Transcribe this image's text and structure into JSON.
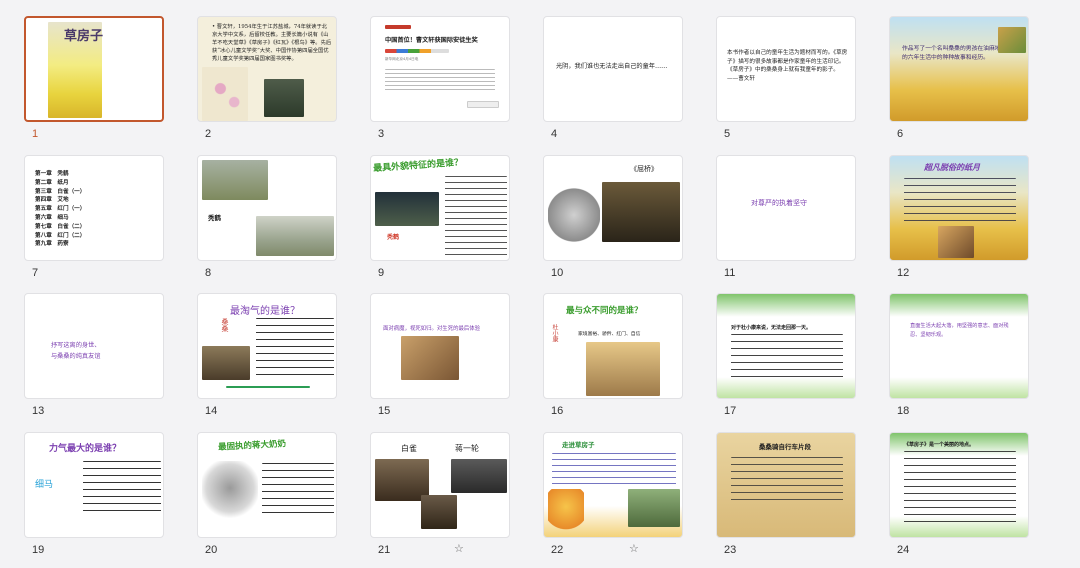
{
  "slides": [
    {
      "num": "1",
      "selected": true,
      "title": "草房子"
    },
    {
      "num": "2",
      "text": "• 曹文轩，1954年生于江苏盐城，74年就读于北京大学中文系，后留校任教。主要长篇小说有《山羊不吃天堂草》《草房子》《红瓦》《根鸟》等。先后获“冰心儿童文学奖”大奖、中国作协第四届全国优秀儿童文学奖第四届国家图书奖等。"
    },
    {
      "num": "3",
      "heading": "中国首位！曹文轩获国际安徒生奖",
      "subline": "新华网北京4月4日电"
    },
    {
      "num": "4",
      "text": "光阴，我们谁也无法走出自己的童年……"
    },
    {
      "num": "5",
      "text": "本书作者以自己的童年生活为题材而写的。《草房子》描写的很多故事都是作家童年的生活印记。《草房子》中的桑桑身上就有我童年的影子。——曹文轩"
    },
    {
      "num": "6",
      "text": "作品写了一个名叫桑桑的男孩在油麻地小学的六年生活中的种种故事和经历。"
    },
    {
      "num": "7",
      "chapters": [
        "第一章　秃鹤",
        "第二章　纸月",
        "第三章　白雀（一）",
        "第四章　艾地",
        "第五章　红门（一）",
        "第六章　细马",
        "第七章　白雀（二）",
        "第八章　红门（二）",
        "第九章　药寮"
      ]
    },
    {
      "num": "8",
      "caption": "秃鹤"
    },
    {
      "num": "9",
      "heading": "最具外貌特征的是谁？",
      "caption": "秃鹤"
    },
    {
      "num": "10",
      "heading": "《屈桥》"
    },
    {
      "num": "11",
      "text": "对尊严的执着坚守"
    },
    {
      "num": "12",
      "heading": "超凡脱俗的纸月"
    },
    {
      "num": "13",
      "text": "抒写这离的身世、\n与桑桑的纯真友谊"
    },
    {
      "num": "14",
      "heading": "最淘气的是谁？",
      "side": "桑桑"
    },
    {
      "num": "15",
      "text": "面对病魔，视死如归。对生死的最后体验"
    },
    {
      "num": "16",
      "heading": "最与众不同的是谁？",
      "side": "杜小康",
      "sub": "家境富裕、骄矜、红门、自信"
    },
    {
      "num": "17",
      "text": "对于杜小康来说，无法走回那一天。"
    },
    {
      "num": "18",
      "text": "直面生活大起大落，用坚强的意志、面对残忍、坚韧乐观。"
    },
    {
      "num": "19",
      "heading": "力气最大的是谁？",
      "side": "细马"
    },
    {
      "num": "20",
      "heading": "最固执的蒋大奶奶"
    },
    {
      "num": "21",
      "caption_left": "白雀",
      "caption_right": "蒋一轮"
    },
    {
      "num": "22",
      "heading": "走进草房子"
    },
    {
      "num": "23",
      "heading": "桑桑骑自行车片段"
    },
    {
      "num": "24",
      "text": "《草房子》是一个美丽的地点。"
    }
  ]
}
